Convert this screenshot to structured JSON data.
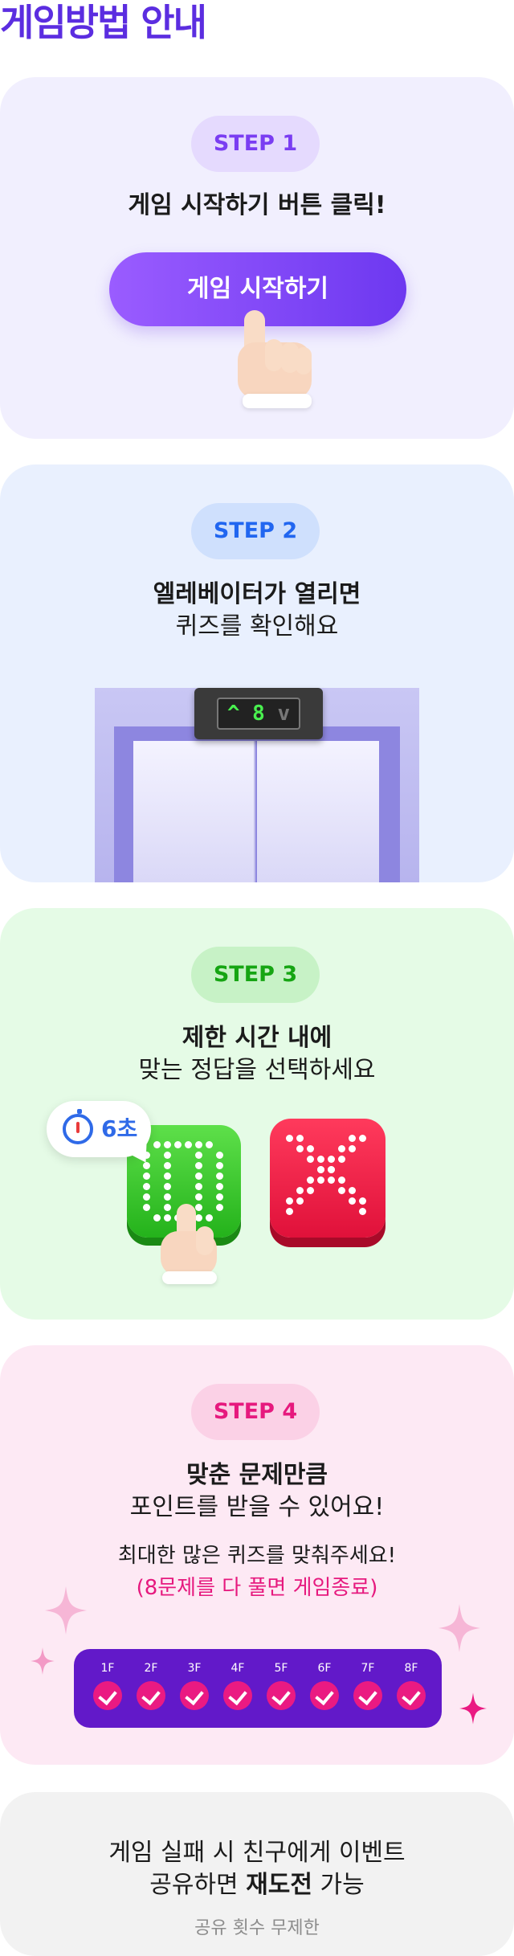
{
  "page": {
    "title": "게임방법 안내"
  },
  "steps": [
    {
      "label": "STEP 1",
      "text": "게임 시작하기 버튼 클릭!",
      "button_label": "게임 시작하기"
    },
    {
      "label": "STEP 2",
      "text_bold": "엘레베이터가 열리면",
      "text": "퀴즈를 확인해요",
      "display_arrow_up": "^",
      "display_digit": "8",
      "display_arrow_down": "v"
    },
    {
      "label": "STEP 3",
      "text_bold": "제한 시간 내에",
      "text": "맞는 정답을 선택하세요",
      "timer": "6초"
    },
    {
      "label": "STEP 4",
      "text_bold": "맞춘 문제만큼",
      "text": "포인트를 받을 수 있어요!",
      "note": "최대한 많은 퀴즈를 맞춰주세요!",
      "note_highlight": "(8문제를 다 풀면 게임종료)",
      "floors": [
        "1F",
        "2F",
        "3F",
        "4F",
        "5F",
        "6F",
        "7F",
        "8F"
      ]
    }
  ],
  "retry": {
    "line1": "게임 실패 시 친구에게 이벤트",
    "line2_prefix": "공유하면 ",
    "line2_bold": "재도전",
    "line2_suffix": " 가능",
    "sub": "공유 횟수 무제한"
  },
  "colors": {
    "title": "#5b2de0",
    "step1_bg": "#f1effe",
    "step2_bg": "#e9f0fe",
    "step3_bg": "#e5fbe6",
    "step4_bg": "#fde9f4",
    "retry_bg": "#f2f2f2",
    "start_button": "#7a42f5",
    "floor_bar": "#6219c9",
    "check": "#ea1a82",
    "correct": "#24b21b",
    "wrong": "#e0113a"
  },
  "icons": [
    "pointing-hand-icon",
    "elevator-icon",
    "stopwatch-icon",
    "o-answer-icon",
    "x-answer-icon",
    "check-icon",
    "sparkle-icon"
  ]
}
